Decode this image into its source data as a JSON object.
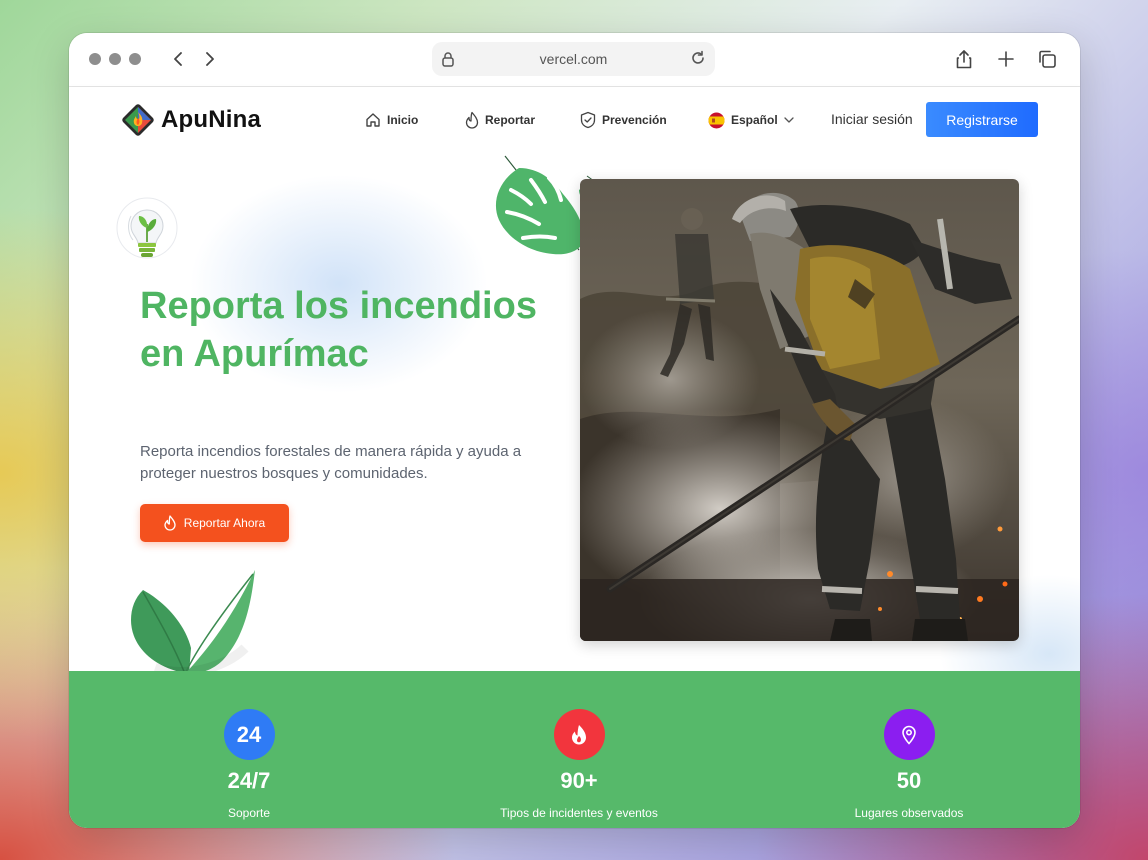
{
  "browser": {
    "url": "vercel.com"
  },
  "header": {
    "brand": "ApuNina",
    "menu": [
      {
        "label": "Inicio",
        "icon": "home-icon"
      },
      {
        "label": "Reportar",
        "icon": "flame-icon"
      },
      {
        "label": "Prevención",
        "icon": "shield-icon"
      },
      {
        "label": "Español",
        "icon": "spain-flag-icon"
      }
    ],
    "login_label": "Iniciar sesión",
    "register_label": "Registrarse"
  },
  "hero": {
    "title": "Reporta los incendios en Apurímac",
    "subtitle": "Reporta incendios forestales de manera rápida y ayuda a proteger nuestros bosques y comunidades.",
    "cta_label": "Reportar Ahora"
  },
  "stats": [
    {
      "badge": "24",
      "value": "24/7",
      "label": "Soporte",
      "color": "#2f7bf5"
    },
    {
      "badge": "",
      "value": "90+",
      "label": "Tipos de incidentes y eventos",
      "color": "#f2353d"
    },
    {
      "badge": "",
      "value": "50",
      "label": "Lugares observados",
      "color": "#8b1ef0"
    }
  ],
  "colors": {
    "brand_green": "#4fb562",
    "cta_orange": "#f4511e",
    "register_blue": "#1f6bff",
    "band_green": "#56b96a"
  }
}
